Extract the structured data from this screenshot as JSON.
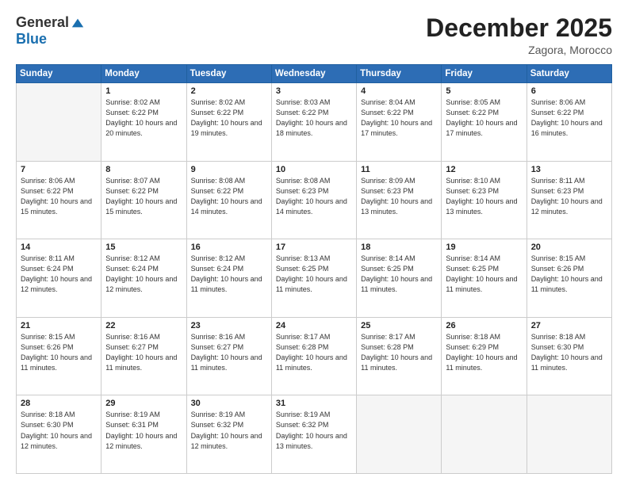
{
  "header": {
    "logo_general": "General",
    "logo_blue": "Blue",
    "month_title": "December 2025",
    "location": "Zagora, Morocco"
  },
  "weekdays": [
    "Sunday",
    "Monday",
    "Tuesday",
    "Wednesday",
    "Thursday",
    "Friday",
    "Saturday"
  ],
  "weeks": [
    [
      {
        "day": "",
        "sunrise": "",
        "sunset": "",
        "daylight": ""
      },
      {
        "day": "1",
        "sunrise": "8:02 AM",
        "sunset": "6:22 PM",
        "daylight": "10 hours and 20 minutes."
      },
      {
        "day": "2",
        "sunrise": "8:02 AM",
        "sunset": "6:22 PM",
        "daylight": "10 hours and 19 minutes."
      },
      {
        "day": "3",
        "sunrise": "8:03 AM",
        "sunset": "6:22 PM",
        "daylight": "10 hours and 18 minutes."
      },
      {
        "day": "4",
        "sunrise": "8:04 AM",
        "sunset": "6:22 PM",
        "daylight": "10 hours and 17 minutes."
      },
      {
        "day": "5",
        "sunrise": "8:05 AM",
        "sunset": "6:22 PM",
        "daylight": "10 hours and 17 minutes."
      },
      {
        "day": "6",
        "sunrise": "8:06 AM",
        "sunset": "6:22 PM",
        "daylight": "10 hours and 16 minutes."
      }
    ],
    [
      {
        "day": "7",
        "sunrise": "8:06 AM",
        "sunset": "6:22 PM",
        "daylight": "10 hours and 15 minutes."
      },
      {
        "day": "8",
        "sunrise": "8:07 AM",
        "sunset": "6:22 PM",
        "daylight": "10 hours and 15 minutes."
      },
      {
        "day": "9",
        "sunrise": "8:08 AM",
        "sunset": "6:22 PM",
        "daylight": "10 hours and 14 minutes."
      },
      {
        "day": "10",
        "sunrise": "8:08 AM",
        "sunset": "6:23 PM",
        "daylight": "10 hours and 14 minutes."
      },
      {
        "day": "11",
        "sunrise": "8:09 AM",
        "sunset": "6:23 PM",
        "daylight": "10 hours and 13 minutes."
      },
      {
        "day": "12",
        "sunrise": "8:10 AM",
        "sunset": "6:23 PM",
        "daylight": "10 hours and 13 minutes."
      },
      {
        "day": "13",
        "sunrise": "8:11 AM",
        "sunset": "6:23 PM",
        "daylight": "10 hours and 12 minutes."
      }
    ],
    [
      {
        "day": "14",
        "sunrise": "8:11 AM",
        "sunset": "6:24 PM",
        "daylight": "10 hours and 12 minutes."
      },
      {
        "day": "15",
        "sunrise": "8:12 AM",
        "sunset": "6:24 PM",
        "daylight": "10 hours and 12 minutes."
      },
      {
        "day": "16",
        "sunrise": "8:12 AM",
        "sunset": "6:24 PM",
        "daylight": "10 hours and 11 minutes."
      },
      {
        "day": "17",
        "sunrise": "8:13 AM",
        "sunset": "6:25 PM",
        "daylight": "10 hours and 11 minutes."
      },
      {
        "day": "18",
        "sunrise": "8:14 AM",
        "sunset": "6:25 PM",
        "daylight": "10 hours and 11 minutes."
      },
      {
        "day": "19",
        "sunrise": "8:14 AM",
        "sunset": "6:25 PM",
        "daylight": "10 hours and 11 minutes."
      },
      {
        "day": "20",
        "sunrise": "8:15 AM",
        "sunset": "6:26 PM",
        "daylight": "10 hours and 11 minutes."
      }
    ],
    [
      {
        "day": "21",
        "sunrise": "8:15 AM",
        "sunset": "6:26 PM",
        "daylight": "10 hours and 11 minutes."
      },
      {
        "day": "22",
        "sunrise": "8:16 AM",
        "sunset": "6:27 PM",
        "daylight": "10 hours and 11 minutes."
      },
      {
        "day": "23",
        "sunrise": "8:16 AM",
        "sunset": "6:27 PM",
        "daylight": "10 hours and 11 minutes."
      },
      {
        "day": "24",
        "sunrise": "8:17 AM",
        "sunset": "6:28 PM",
        "daylight": "10 hours and 11 minutes."
      },
      {
        "day": "25",
        "sunrise": "8:17 AM",
        "sunset": "6:28 PM",
        "daylight": "10 hours and 11 minutes."
      },
      {
        "day": "26",
        "sunrise": "8:18 AM",
        "sunset": "6:29 PM",
        "daylight": "10 hours and 11 minutes."
      },
      {
        "day": "27",
        "sunrise": "8:18 AM",
        "sunset": "6:30 PM",
        "daylight": "10 hours and 11 minutes."
      }
    ],
    [
      {
        "day": "28",
        "sunrise": "8:18 AM",
        "sunset": "6:30 PM",
        "daylight": "10 hours and 12 minutes."
      },
      {
        "day": "29",
        "sunrise": "8:19 AM",
        "sunset": "6:31 PM",
        "daylight": "10 hours and 12 minutes."
      },
      {
        "day": "30",
        "sunrise": "8:19 AM",
        "sunset": "6:32 PM",
        "daylight": "10 hours and 12 minutes."
      },
      {
        "day": "31",
        "sunrise": "8:19 AM",
        "sunset": "6:32 PM",
        "daylight": "10 hours and 13 minutes."
      },
      {
        "day": "",
        "sunrise": "",
        "sunset": "",
        "daylight": ""
      },
      {
        "day": "",
        "sunrise": "",
        "sunset": "",
        "daylight": ""
      },
      {
        "day": "",
        "sunrise": "",
        "sunset": "",
        "daylight": ""
      }
    ]
  ]
}
